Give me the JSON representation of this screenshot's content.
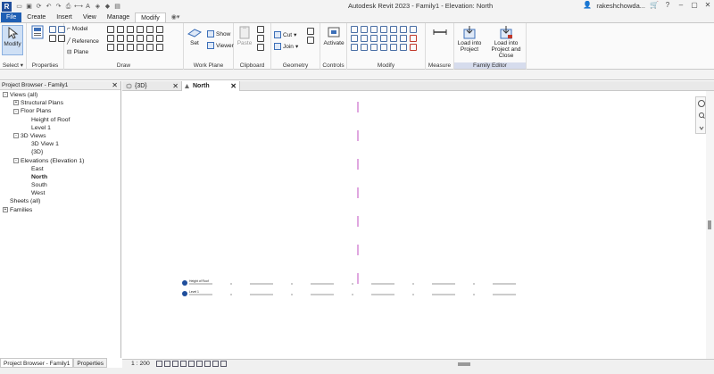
{
  "app": {
    "title": "Autodesk Revit 2023 - Family1 - Elevation: North",
    "logo": "R",
    "user": "rakeshchowda..."
  },
  "ribbon_tabs": [
    "File",
    "Create",
    "Insert",
    "View",
    "Manage",
    "Modify"
  ],
  "ribbon": {
    "modify_label": "Modify",
    "model_label": "Model",
    "reference_label": "Reference",
    "plane_label": "Plane",
    "set_label": "Set",
    "show_label": "Show",
    "viewer_label": "Viewer",
    "paste_label": "Paste",
    "cut_label": "Cut",
    "join_label": "Join",
    "activate_label": "Activate",
    "load_project_label": "Load into Project",
    "load_close_label": "Load into Project and Close",
    "panels": {
      "select": "Select",
      "properties": "Properties",
      "draw": "Draw",
      "work_plane": "Work Plane",
      "clipboard": "Clipboard",
      "geometry": "Geometry",
      "controls": "Controls",
      "modify": "Modify",
      "measure": "Measure",
      "family_editor": "Family Editor"
    }
  },
  "project_browser": {
    "title": "Project Browser - Family1",
    "tree": [
      {
        "label": "Views (all)",
        "level": 0,
        "toggle": "-"
      },
      {
        "label": "Structural Plans",
        "level": 1,
        "toggle": "+"
      },
      {
        "label": "Floor Plans",
        "level": 1,
        "toggle": "-"
      },
      {
        "label": "Height of Roof",
        "level": 2,
        "toggle": ""
      },
      {
        "label": "Level 1",
        "level": 2,
        "toggle": ""
      },
      {
        "label": "3D Views",
        "level": 1,
        "toggle": "-"
      },
      {
        "label": "3D View 1",
        "level": 2,
        "toggle": ""
      },
      {
        "label": "{3D}",
        "level": 2,
        "toggle": ""
      },
      {
        "label": "Elevations (Elevation 1)",
        "level": 1,
        "toggle": "-"
      },
      {
        "label": "East",
        "level": 2,
        "toggle": ""
      },
      {
        "label": "North",
        "level": 2,
        "toggle": "",
        "bold": true
      },
      {
        "label": "South",
        "level": 2,
        "toggle": ""
      },
      {
        "label": "West",
        "level": 2,
        "toggle": ""
      },
      {
        "label": "Sheets (all)",
        "level": 0,
        "toggle": ""
      },
      {
        "label": "Families",
        "level": 0,
        "toggle": "+"
      }
    ],
    "footer_tabs": [
      "Project Browser - Family1",
      "Properties"
    ]
  },
  "view_tabs": [
    {
      "label": "{3D}"
    },
    {
      "label": "North"
    }
  ],
  "canvas": {
    "level_top": "Height of Roof",
    "level_bottom": "Level 1"
  },
  "viewbar": {
    "scale": "1 : 200"
  },
  "colors": {
    "file_tab": "#1f5fb4",
    "ref_plane": "#c04fc0",
    "family_editor_band": "#d6dced"
  }
}
